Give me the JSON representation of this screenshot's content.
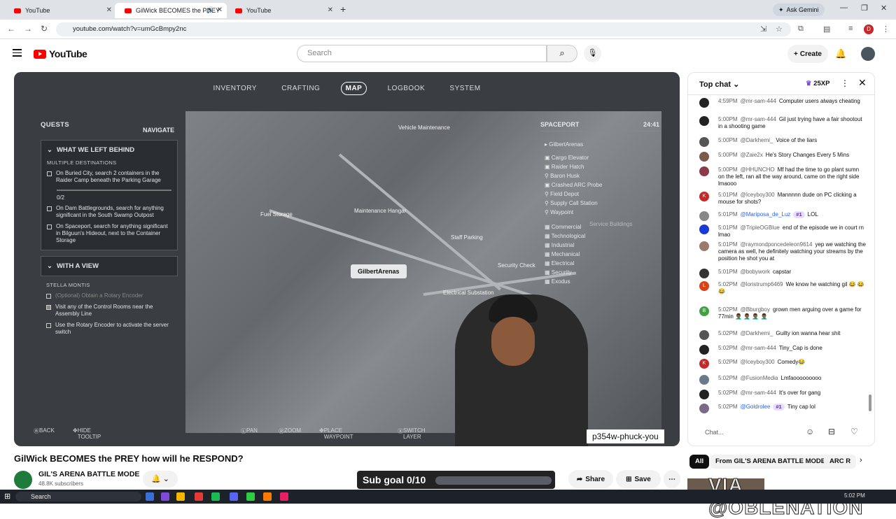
{
  "browser": {
    "tabs": [
      {
        "label": "YouTube",
        "active": false
      },
      {
        "label": "GilWick BECOMES the PREY",
        "active": true
      },
      {
        "label": "YouTube",
        "active": false
      }
    ],
    "new_tab": "+",
    "ask_gemini": "Ask Gemini",
    "url": "youtube.com/watch?v=umGcBmpy2nc",
    "profile_initial": "D"
  },
  "youtube": {
    "logo": "YouTube",
    "search_placeholder": "Search",
    "create_label": "Create"
  },
  "game": {
    "tabs": [
      "INVENTORY",
      "CRAFTING",
      "MAP",
      "LOGBOOK",
      "SYSTEM"
    ],
    "active_tab": "MAP",
    "navigate": "NAVIGATE",
    "quests_label": "QUESTS",
    "quest1": {
      "title": "WHAT WE LEFT BEHIND",
      "subheader": "MULTIPLE DESTINATIONS",
      "items": [
        "On Buried City, search 2 containers in the Raider Camp beneath the Parking Garage",
        "0/2",
        "On Dam Battlegrounds, search for anything significant in the South Swamp Outpost",
        "On Spaceport, search for anything significant in Bilguun's Hideout, next to the Container Storage"
      ]
    },
    "quest2": {
      "title": "WITH A VIEW",
      "subheader": "STELLA MONTIS",
      "items": [
        "(Optional) Obtain a Rotary Encoder",
        "Visit any of the Control Rooms near the Assembly Line",
        "Use the Rotary Encoder to activate the server switch"
      ]
    },
    "map_labels": {
      "vehicle": "Vehicle Maintenance",
      "fuel": "Fuel Storage",
      "hangar": "Maintenance Hangar",
      "staff": "Staff Parking",
      "security": "Security Check",
      "electrical": "Electrical Substation",
      "service": "Service Buildings",
      "pin": "GilbertArenas"
    },
    "spaceport": {
      "title": "SPACEPORT",
      "time": "24:41",
      "player": "GilbertArenas",
      "items": [
        "Cargo Elevator",
        "Raider Hatch",
        "Baron Husk",
        "Crashed ARC Probe",
        "Field Depot",
        "Supply Call Station",
        "Waypoint"
      ],
      "layers": [
        "Commercial",
        "Technological",
        "Industrial",
        "Mechanical",
        "Electrical",
        "Security",
        "Exodus"
      ]
    },
    "controls": [
      "BACK",
      "HIDE TOOLTIP",
      "PAN",
      "ZOOM",
      "PLACE WAYPOINT",
      "SWITCH LAYER"
    ]
  },
  "overlay_handle": "p354w-phuck-you",
  "video": {
    "title": "GilWick BECOMES the PREY how will he RESPOND?",
    "channel": "GIL'S ARENA BATTLE MODE",
    "subscribers": "48.8K subscribers",
    "subgoal": "Sub goal 0/10",
    "subgoal_progress": 0,
    "share": "Share",
    "save": "Save"
  },
  "chat": {
    "header": "Top chat",
    "xp": "25XP",
    "input_placeholder": "Chat...",
    "messages": [
      {
        "time": "4:59PM",
        "author": "@mr-sam-444",
        "text": "Computer users always cheating",
        "avatar": "",
        "color": "#222"
      },
      {
        "time": "5:00PM",
        "author": "@mr-sam-444",
        "text": "Gil just trying have a fair shootout in a shooting game",
        "avatar": "",
        "color": "#222"
      },
      {
        "time": "5:00PM",
        "author": "@Darkhemi_",
        "text": "Voice of the liars",
        "avatar": "",
        "color": "#555"
      },
      {
        "time": "5:00PM",
        "author": "@Zaie2x",
        "text": "He's Story Changes Every 5 Mins",
        "avatar": "",
        "color": "#7a5a4a"
      },
      {
        "time": "5:00PM",
        "author": "@HHUNCHO",
        "text": "Mf had the time to go plant sumn on the left, ran all the way around, came on the right side lmaooo",
        "avatar": "",
        "color": "#8a3a4a"
      },
      {
        "time": "5:01PM",
        "author": "@Iceyboy300",
        "text": "Mannnnn dude on PC clicking a mouse for shots?",
        "avatar": "K",
        "color": "#c62828"
      },
      {
        "time": "5:01PM",
        "author": "@Mariposa_de_Luz",
        "text": "LOL",
        "avatar": "",
        "color": "#888",
        "badge": "#1",
        "mod": true
      },
      {
        "time": "5:01PM",
        "author": "@TripleOGBlue",
        "text": "end of the episode we in court rn lmao",
        "avatar": "",
        "color": "#1a3ad8"
      },
      {
        "time": "5:01PM",
        "author": "@raymondponcedeleon9614",
        "text": "yep we watching the camera as well, he definitely watching your streams by the position he shot you at",
        "avatar": "",
        "color": "#9a7a6a"
      },
      {
        "time": "5:01PM",
        "author": "@bobywork",
        "text": "capstar",
        "avatar": "",
        "color": "#333"
      },
      {
        "time": "5:02PM",
        "author": "@loristrump6469",
        "text": "We know he watching gil 😂 😂 😂",
        "avatar": "L",
        "color": "#d84315"
      },
      {
        "time": "5:02PM",
        "author": "@Bburgboy",
        "text": "grown men arguing over a game for 77min 🤦🏾‍♂️ 🤦🏾‍♂️ 🤦🏾‍♂️ 🤦🏾‍♂️",
        "avatar": "B",
        "color": "#43a047"
      },
      {
        "time": "5:02PM",
        "author": "@Darkhemi_",
        "text": "Guilty ion wanna hear shit",
        "avatar": "",
        "color": "#555"
      },
      {
        "time": "5:02PM",
        "author": "@mr-sam-444",
        "text": "Tiny_Cap is done",
        "avatar": "",
        "color": "#222"
      },
      {
        "time": "5:02PM",
        "author": "@Iceyboy300",
        "text": "Comedy😂",
        "avatar": "K",
        "color": "#c62828"
      },
      {
        "time": "5:02PM",
        "author": "@FusionMedia",
        "text": "Lmfaooooooooo",
        "avatar": "",
        "color": "#6a7a8a"
      },
      {
        "time": "5:02PM",
        "author": "@mr-sam-444",
        "text": "It's over for gang",
        "avatar": "",
        "color": "#222"
      },
      {
        "time": "5:02PM",
        "author": "@Goldrolee",
        "text": "Tiny cap lol",
        "avatar": "",
        "color": "#7a6a8a",
        "badge": "#1",
        "mod": true
      }
    ]
  },
  "recommendations": {
    "chips": [
      "All",
      "From GIL'S ARENA BATTLE MODE",
      "ARC R"
    ],
    "watermark": "VIA @OBLENATION"
  },
  "taskbar": {
    "search": "Search",
    "clock": "5:02 PM"
  }
}
